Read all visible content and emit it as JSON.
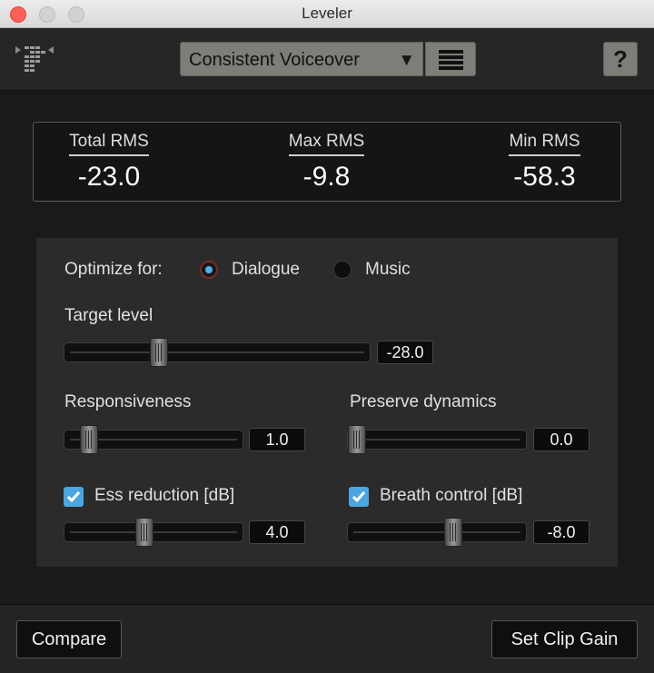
{
  "window": {
    "title": "Leveler"
  },
  "toolbar": {
    "logo_icon": "leveler-logo-icon",
    "preset": "Consistent Voiceover",
    "preset_arrow": "▼",
    "preset_menu_icon": "hamburger-list-icon",
    "help_label": "?"
  },
  "rms": {
    "total": {
      "label": "Total RMS",
      "value": "-23.0"
    },
    "max": {
      "label": "Max RMS",
      "value": "-9.8"
    },
    "min": {
      "label": "Min RMS",
      "value": "-58.3"
    }
  },
  "optimize": {
    "label": "Optimize for:",
    "options": [
      {
        "label": "Dialogue",
        "selected": true
      },
      {
        "label": "Music",
        "selected": false
      }
    ]
  },
  "target_level": {
    "label": "Target level",
    "value": "-28.0",
    "fraction": 0.31
  },
  "responsiveness": {
    "label": "Responsiveness",
    "value": "1.0",
    "fraction": 0.14
  },
  "preserve_dynamics": {
    "label": "Preserve dynamics",
    "value": "0.0",
    "fraction": 0.05
  },
  "ess_reduction": {
    "label": "Ess reduction [dB]",
    "value": "4.0",
    "fraction": 0.45,
    "checked": true
  },
  "breath_control": {
    "label": "Breath control [dB]",
    "value": "-8.0",
    "fraction": 0.59,
    "checked": true
  },
  "colors": {
    "accent": "#4fb3ec",
    "checkbox": "#4da6df",
    "preset_bg": "#7b7f78"
  },
  "footer": {
    "compare_label": "Compare",
    "set_clip_gain_label": "Set Clip Gain"
  }
}
